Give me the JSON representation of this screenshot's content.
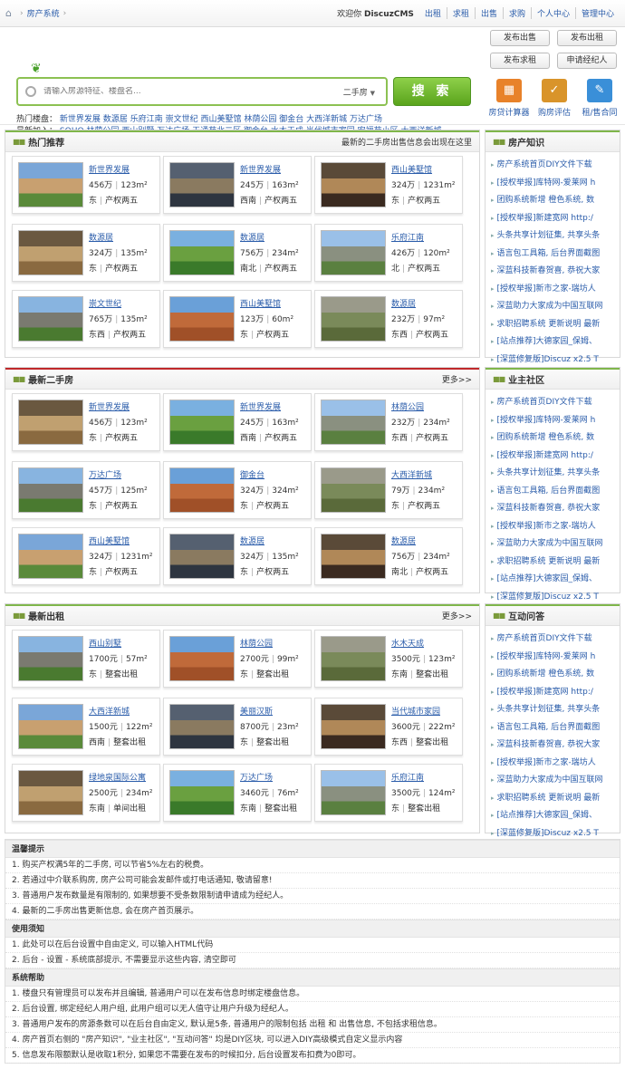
{
  "topbar": {
    "crumb": "房产系统",
    "welcome_prefix": "欢迎你",
    "welcome_user": "DiscuzCMS",
    "links": [
      "出租",
      "求租",
      "出售",
      "求购",
      "个人中心",
      "管理中心"
    ]
  },
  "search": {
    "placeholder": "请输入房源特征、楼盘名...",
    "category": "二手房",
    "button": "搜 索",
    "hot_label": "热门楼盘：",
    "hot": [
      "新世界发展",
      "数源居",
      "乐府江南",
      "崇文世纪",
      "西山美墅馆",
      "林荫公园",
      "御金台",
      "大西洋新城",
      "万达广场"
    ],
    "recent_label": "最新加入：",
    "recent": [
      "SOHO",
      "林荫公园",
      "西山别墅",
      "万达广场",
      "天通苑北二区",
      "御金台",
      "水木天成",
      "当代城市家园",
      "宏福苑小区",
      "大西洋新城"
    ]
  },
  "actions": {
    "buttons": [
      "发布出售",
      "发布出租",
      "发布求租",
      "申请经纪人"
    ],
    "tools": [
      {
        "label": "房贷计算器",
        "icon": "calculator-icon",
        "color": "#e8822a",
        "glyph": "▦"
      },
      {
        "label": "购房评估",
        "icon": "checklist-icon",
        "color": "#d9942a",
        "glyph": "✓"
      },
      {
        "label": "租/售合同",
        "icon": "contract-icon",
        "color": "#3a8fd8",
        "glyph": "✎"
      }
    ]
  },
  "hot": {
    "title": "热门推荐",
    "note": "最新的二手房出售信息会出现在这里",
    "items": [
      {
        "name": "新世界发展",
        "price": "456万",
        "area": "123m²",
        "dir": "东",
        "type": "产权两五"
      },
      {
        "name": "新世界发展",
        "price": "245万",
        "area": "163m²",
        "dir": "西南",
        "type": "产权两五"
      },
      {
        "name": "西山美墅馆",
        "price": "324万",
        "area": "1231m²",
        "dir": "东",
        "type": "产权两五"
      },
      {
        "name": "数源居",
        "price": "324万",
        "area": "135m²",
        "dir": "东",
        "type": "产权两五"
      },
      {
        "name": "数源居",
        "price": "756万",
        "area": "234m²",
        "dir": "南北",
        "type": "产权两五"
      },
      {
        "name": "乐府江南",
        "price": "426万",
        "area": "120m²",
        "dir": "北",
        "type": "产权两五"
      },
      {
        "name": "崇文世纪",
        "price": "765万",
        "area": "135m²",
        "dir": "东西",
        "type": "产权两五"
      },
      {
        "name": "西山美墅馆",
        "price": "123万",
        "area": "60m²",
        "dir": "东",
        "type": "产权两五"
      },
      {
        "name": "数源居",
        "price": "232万",
        "area": "97m²",
        "dir": "东西",
        "type": "产权两五"
      }
    ]
  },
  "sale": {
    "title": "最新二手房",
    "more": "更多>>",
    "items": [
      {
        "name": "新世界发展",
        "price": "456万",
        "area": "123m²",
        "dir": "东",
        "type": "产权两五"
      },
      {
        "name": "新世界发展",
        "price": "245万",
        "area": "163m²",
        "dir": "西南",
        "type": "产权两五"
      },
      {
        "name": "林荫公园",
        "price": "232万",
        "area": "234m²",
        "dir": "东西",
        "type": "产权两五"
      },
      {
        "name": "万达广场",
        "price": "457万",
        "area": "125m²",
        "dir": "东",
        "type": "产权两五"
      },
      {
        "name": "御金台",
        "price": "324万",
        "area": "324m²",
        "dir": "东",
        "type": "产权两五"
      },
      {
        "name": "大西洋新城",
        "price": "79万",
        "area": "234m²",
        "dir": "东",
        "type": "产权两五"
      },
      {
        "name": "西山美墅馆",
        "price": "324万",
        "area": "1231m²",
        "dir": "东",
        "type": "产权两五"
      },
      {
        "name": "数源居",
        "price": "324万",
        "area": "135m²",
        "dir": "东",
        "type": "产权两五"
      },
      {
        "name": "数源居",
        "price": "756万",
        "area": "234m²",
        "dir": "南北",
        "type": "产权两五"
      }
    ]
  },
  "rent": {
    "title": "最新出租",
    "more": "更多>>",
    "items": [
      {
        "name": "西山别墅",
        "price": "1700元",
        "area": "57m²",
        "dir": "东",
        "type": "整套出租"
      },
      {
        "name": "林荫公园",
        "price": "2700元",
        "area": "99m²",
        "dir": "东",
        "type": "整套出租"
      },
      {
        "name": "水木天成",
        "price": "3500元",
        "area": "123m²",
        "dir": "东南",
        "type": "整套出租"
      },
      {
        "name": "大西洋新城",
        "price": "1500元",
        "area": "122m²",
        "dir": "西南",
        "type": "整套出租"
      },
      {
        "name": "美丽汉斯",
        "price": "8700元",
        "area": "23m²",
        "dir": "东",
        "type": "整套出租"
      },
      {
        "name": "当代城市家园",
        "price": "3600元",
        "area": "222m²",
        "dir": "东西",
        "type": "整套出租"
      },
      {
        "name": "绿地泉国际公寓",
        "price": "2500元",
        "area": "234m²",
        "dir": "东南",
        "type": "单间出租"
      },
      {
        "name": "万达广场",
        "price": "3460元",
        "area": "76m²",
        "dir": "东南",
        "type": "整套出租"
      },
      {
        "name": "乐府江南",
        "price": "3500元",
        "area": "124m²",
        "dir": "东",
        "type": "整套出租"
      }
    ]
  },
  "sidebars": [
    {
      "title": "房产知识",
      "items": [
        "房产系统首页DIY文件下载",
        "[授权举报]库特网-爱莱网 h",
        "团购系统新增 橙色系统, 数",
        "[授权举报]新建宽网 http:/",
        "头条共享计划征集, 共享头条",
        "语言包工具箱, 后台界面截图",
        "深蓝科技新春贺喜, 恭祝大家",
        "[授权举报]新市之家-瑞坊人",
        "深蓝助力大家成为中国互联网",
        "求职招聘系统 更新说明 最新",
        "[站点推荐]大德家园_保姆、",
        "[深蓝修复版]Discuz x2.5 T"
      ]
    },
    {
      "title": "业主社区",
      "items": [
        "房产系统首页DIY文件下载",
        "[授权举报]库特网-爱莱网 h",
        "团购系统新增 橙色系统, 数",
        "[授权举报]新建宽网 http:/",
        "头条共享计划征集, 共享头条",
        "语言包工具箱, 后台界面截图",
        "深蓝科技新春贺喜, 恭祝大家",
        "[授权举报]新市之家-瑞坊人",
        "深蓝助力大家成为中国互联网",
        "求职招聘系统 更新说明 最新",
        "[站点推荐]大德家园_保姆、",
        "[深蓝修复版]Discuz x2.5 T"
      ]
    },
    {
      "title": "互动问答",
      "items": [
        "房产系统首页DIY文件下载",
        "[授权举报]库特网-爱莱网 h",
        "团购系统新增 橙色系统, 数",
        "[授权举报]新建宽网 http:/",
        "头条共享计划征集, 共享头条",
        "语言包工具箱, 后台界面截图",
        "深蓝科技新春贺喜, 恭祝大家",
        "[授权举报]新市之家-瑞坊人",
        "深蓝助力大家成为中国互联网",
        "求职招聘系统 更新说明 最新",
        "[站点推荐]大德家园_保姆、",
        "[深蓝修复版]Discuz x2.5 T"
      ]
    }
  ],
  "notes": [
    {
      "title": "温馨提示",
      "lines": [
        "1. 购买产权满5年的二手房, 可以节省5%左右的税费。",
        "2. 若通过中介联系购房, 房产公司可能会发邮件或打电话通知, 敬请留意!",
        "3. 普通用户发布数量是有限制的, 如果想要不受条数限制请申请成为经纪人。",
        "4. 最新的二手房出售更新信息, 会在房产首页展示。"
      ]
    },
    {
      "title": "使用须知",
      "lines": [
        "1. 此处可以在后台设置中自由定义, 可以输入HTML代码",
        "2. 后台 - 设置 - 系统底部提示, 不需要显示这些内容, 清空即可"
      ]
    },
    {
      "title": "系统帮助",
      "lines": [
        "1. 楼盘只有管理员可以发布并且编辑, 普通用户可以在发布信息时绑定楼盘信息。",
        "2. 后台设置, 绑定经纪人用户组, 此用户组可以无人值守让用户升级为经纪人。",
        "3. 普通用户发布的房源条数可以在后台自由定义, 默认是5条, 普通用户的限制包括 出租 和 出售信息, 不包括求租信息。",
        "4. 房产首页右侧的 \"房产知识\", \"业主社区\", \"互动问答\" 均是DIY区块, 可以进入DIY高级模式自定义显示内容",
        "5. 信息发布限额默认是收取1积分, 如果您不需要在发布的时候扣分, 后台设置发布扣费为0即可。"
      ]
    }
  ]
}
